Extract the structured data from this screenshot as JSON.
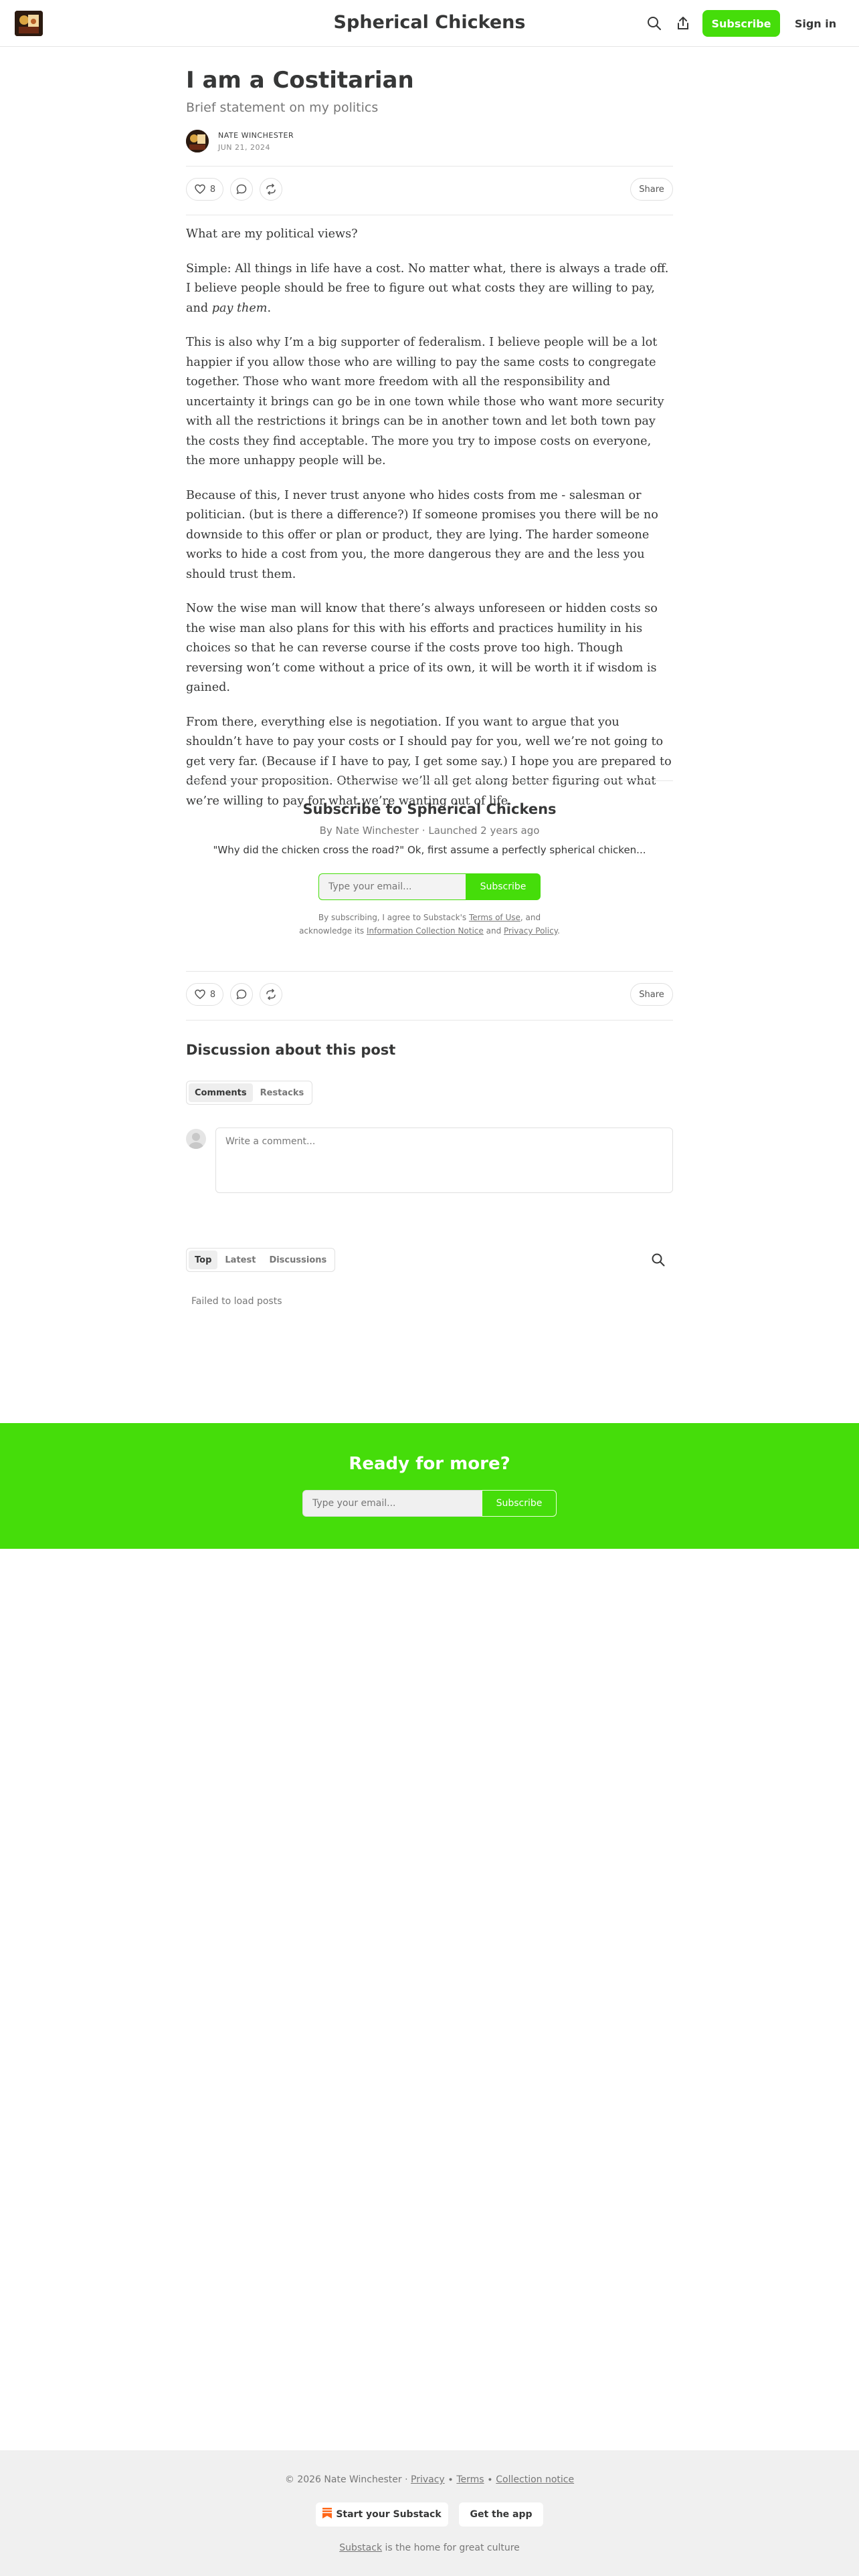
{
  "header": {
    "site_title": "Spherical Chickens",
    "subscribe_label": "Subscribe",
    "signin_label": "Sign in"
  },
  "post": {
    "title": "I am a Costitarian",
    "subtitle": "Brief statement on my politics",
    "author": "NATE WINCHESTER",
    "date": "JUN 21, 2024",
    "likes": "8",
    "share_label": "Share",
    "paragraphs": [
      "What are my political views?",
      "Simple: All things in life have a cost. No matter what, there is always a trade off. I believe people should be free to figure out what costs they are willing to pay, and ",
      "This is also why I’m a big supporter of federalism. I believe people will be a lot happier if you allow those who are willing to pay the same costs to congregate together. Those who want more freedom with all the responsibility and uncertainty it brings can go be in one town while those who want more security with all the restrictions it brings can be in another town and let both town pay the costs they find acceptable. The more you try to impose costs on everyone, the more unhappy people will be.",
      "Because of this, I never trust anyone who hides costs from me - salesman or politician. (but is there a difference?) If someone promises you there will be no downside to this offer or plan or product, they are lying. The harder someone works to hide a cost from you, the more dangerous they are and the less you should trust them.",
      "Now the wise man will know that there’s always unforeseen or hidden costs so the wise man also plans for this with his efforts and practices humility in his choices so that he can reverse course if the costs prove too high. Though reversing won’t come without a price of its own, it will be worth it if wisdom is gained.",
      "From there, everything else is negotiation. If you want to argue that you shouldn’t have to pay your costs or I should pay for you, well we’re not going to get very far. (Because if I have to pay, I get some say.) I hope you are prepared to defend your proposition. Otherwise we’ll all get along better figuring out what we’re willing to pay for what we’re wanting out of life."
    ],
    "p2_emphasis": "pay them",
    "p2_end": "."
  },
  "subscribe_box": {
    "title": "Subscribe to Spherical Chickens",
    "meta": "By Nate Winchester · Launched 2 years ago",
    "description": "\"Why did the chicken cross the road?\" Ok, first assume a perfectly spherical chicken...",
    "email_placeholder": "Type your email...",
    "button_label": "Subscribe",
    "legal_prefix": "By subscribing, I agree to Substack's ",
    "terms_link": "Terms of Use",
    "legal_mid": ", and acknowledge its ",
    "notice_link": "Information Collection Notice",
    "legal_and": " and ",
    "privacy_link": "Privacy Policy",
    "legal_end": "."
  },
  "discussion": {
    "title": "Discussion about this post",
    "tabs": [
      "Comments",
      "Restacks"
    ],
    "comment_placeholder": "Write a comment..."
  },
  "archive": {
    "tabs": [
      "Top",
      "Latest",
      "Discussions"
    ],
    "status": "Failed to load posts"
  },
  "ready": {
    "title": "Ready for more?",
    "email_placeholder": "Type your email...",
    "button_label": "Subscribe"
  },
  "footer": {
    "copyright": "© 2026 Nate Winchester · ",
    "privacy": "Privacy",
    "sep": " ∙ ",
    "terms": "Terms",
    "collection": "Collection notice",
    "start_label": "Start your Substack",
    "app_label": "Get the app",
    "substack_link": "Substack",
    "tagline": " is the home for great culture"
  },
  "colors": {
    "accent": "#45dd0a",
    "text": "#363737",
    "muted": "#777777",
    "footer_bg": "#f0f0f0"
  }
}
